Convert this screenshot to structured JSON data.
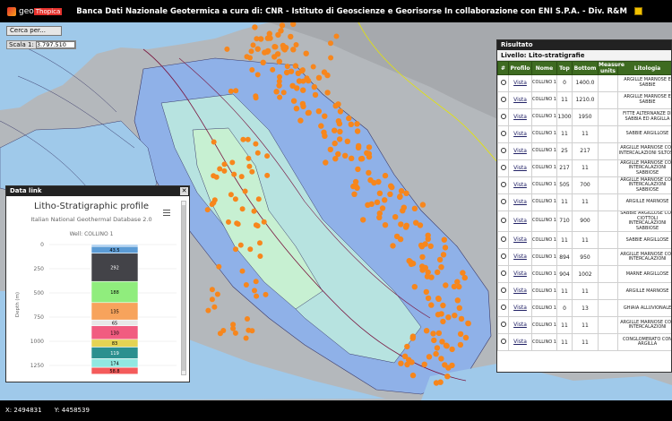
{
  "app": {
    "logo_text": "geo",
    "logo_brand": "Thopica",
    "title": "Banca Dati Nazionale Geotermica a cura di: CNR - Istituto di Geoscienze e Georisorse    In collaborazione con ENI S.P.A. - Div. R&M"
  },
  "toolbar": {
    "search_label": "Cerca per...",
    "scale_label": "Scala 1:",
    "scale_value": "3.797.510"
  },
  "data_panel": {
    "title": "Data link",
    "chart_data": {
      "type": "bar",
      "title": "Litho-Stratigraphic profile",
      "subtitle": "Italian National Geothermal Database 2.0",
      "well": "Well: COLLINO 1",
      "ylabel": "Depth (m)",
      "ylim": [
        0,
        1250
      ],
      "yticks": [
        0,
        250,
        500,
        750,
        1000,
        1250
      ],
      "layers": [
        {
          "top": 0,
          "bottom": 20,
          "color": "#9ec8f0",
          "label": ""
        },
        {
          "top": 20,
          "bottom": 90,
          "color": "#5b9bd5",
          "label": "43.5"
        },
        {
          "top": 90,
          "bottom": 382,
          "color": "#434348",
          "label": "292"
        },
        {
          "top": 382,
          "bottom": 600,
          "color": "#90ed7d",
          "label": "188"
        },
        {
          "top": 600,
          "bottom": 780,
          "color": "#f7a35c",
          "label": "135"
        },
        {
          "top": 780,
          "bottom": 840,
          "color": "#e8e8e8",
          "label": "65"
        },
        {
          "top": 840,
          "bottom": 980,
          "color": "#f15c80",
          "label": "130"
        },
        {
          "top": 980,
          "bottom": 1060,
          "color": "#e4d354",
          "label": "83"
        },
        {
          "top": 1060,
          "bottom": 1180,
          "color": "#2b908f",
          "label": "119"
        },
        {
          "top": 1180,
          "bottom": 1270,
          "color": "#91e8e1",
          "label": "174"
        },
        {
          "top": 1270,
          "bottom": 1340,
          "color": "#f45b5b",
          "label": "58.8"
        }
      ]
    }
  },
  "result_panel": {
    "title": "Risultato",
    "level_label": "Livello: Lito-stratigrafie",
    "columns": [
      "#",
      "Profilo",
      "Nome",
      "Top",
      "Bottom",
      "Measure units",
      "Litologia"
    ],
    "rows": [
      {
        "link": "Vista",
        "name": "COLLINO 1",
        "top": "0",
        "bottom": "1400.0",
        "units": "",
        "litho": "ARGILLE MARNOSE E SABBIE"
      },
      {
        "link": "Vista",
        "name": "COLLINO 1",
        "top": "11",
        "bottom": "1210.0",
        "units": "",
        "litho": "ARGILLE MARNOSE E SABBIE"
      },
      {
        "link": "Vista",
        "name": "COLLINO 1",
        "top": "1300",
        "bottom": "1950",
        "units": "",
        "litho": "FITTE ALTERNANZE DI SABBIA ED ARGILLA"
      },
      {
        "link": "Vista",
        "name": "COLLINO 1",
        "top": "11",
        "bottom": "11",
        "units": "",
        "litho": "SABBIE ARGILLOSE"
      },
      {
        "link": "Vista",
        "name": "COLLINO 1",
        "top": "25",
        "bottom": "217",
        "units": "",
        "litho": "ARGILLE MARNOSE CON INTERCALAZIONI SILTOSE"
      },
      {
        "link": "Vista",
        "name": "COLLINO 1",
        "top": "217",
        "bottom": "11",
        "units": "",
        "litho": "ARGILLE MARNOSE CON INTERCALAZIONI SABBIOSE"
      },
      {
        "link": "Vista",
        "name": "COLLINO 1",
        "top": "505",
        "bottom": "700",
        "units": "",
        "litho": "ARGILLE MARNOSE CON INTERCALAZIONI SABBIOSE"
      },
      {
        "link": "Vista",
        "name": "COLLINO 1",
        "top": "11",
        "bottom": "11",
        "units": "",
        "litho": "ARGILLE MARNOSE"
      },
      {
        "link": "Vista",
        "name": "COLLINO 1",
        "top": "710",
        "bottom": "900",
        "units": "",
        "litho": "SABBIE ARGILLOSE CON CIOTTOLI INTERCALAZIONI SABBIOSE"
      },
      {
        "link": "Vista",
        "name": "COLLINO 1",
        "top": "11",
        "bottom": "11",
        "units": "",
        "litho": "SABBIE ARGILLOSE"
      },
      {
        "link": "Vista",
        "name": "COLLINO 1",
        "top": "894",
        "bottom": "950",
        "units": "",
        "litho": "ARGILLE MARNOSE CON INTERCALAZIONI"
      },
      {
        "link": "Vista",
        "name": "COLLINO 1",
        "top": "904",
        "bottom": "1002",
        "units": "",
        "litho": "MARNE ARGILLOSE"
      },
      {
        "link": "Vista",
        "name": "COLLINO 1",
        "top": "11",
        "bottom": "11",
        "units": "",
        "litho": "ARGILLE MARNOSE"
      },
      {
        "link": "Vista",
        "name": "COLLINO 1",
        "top": "0",
        "bottom": "13",
        "units": "",
        "litho": "GHIAIA ALLUVIONALE"
      },
      {
        "link": "Vista",
        "name": "COLLINO 1",
        "top": "11",
        "bottom": "11",
        "units": "",
        "litho": "ARGILLE MARNOSE CON INTERCALAZIONI"
      },
      {
        "link": "Vista",
        "name": "COLLINO 1",
        "top": "11",
        "bottom": "11",
        "units": "",
        "litho": "CONGLOMERATO CON ARGILLA"
      }
    ]
  },
  "status": {
    "x": "X: 2494831",
    "y": "Y: 4458539"
  }
}
